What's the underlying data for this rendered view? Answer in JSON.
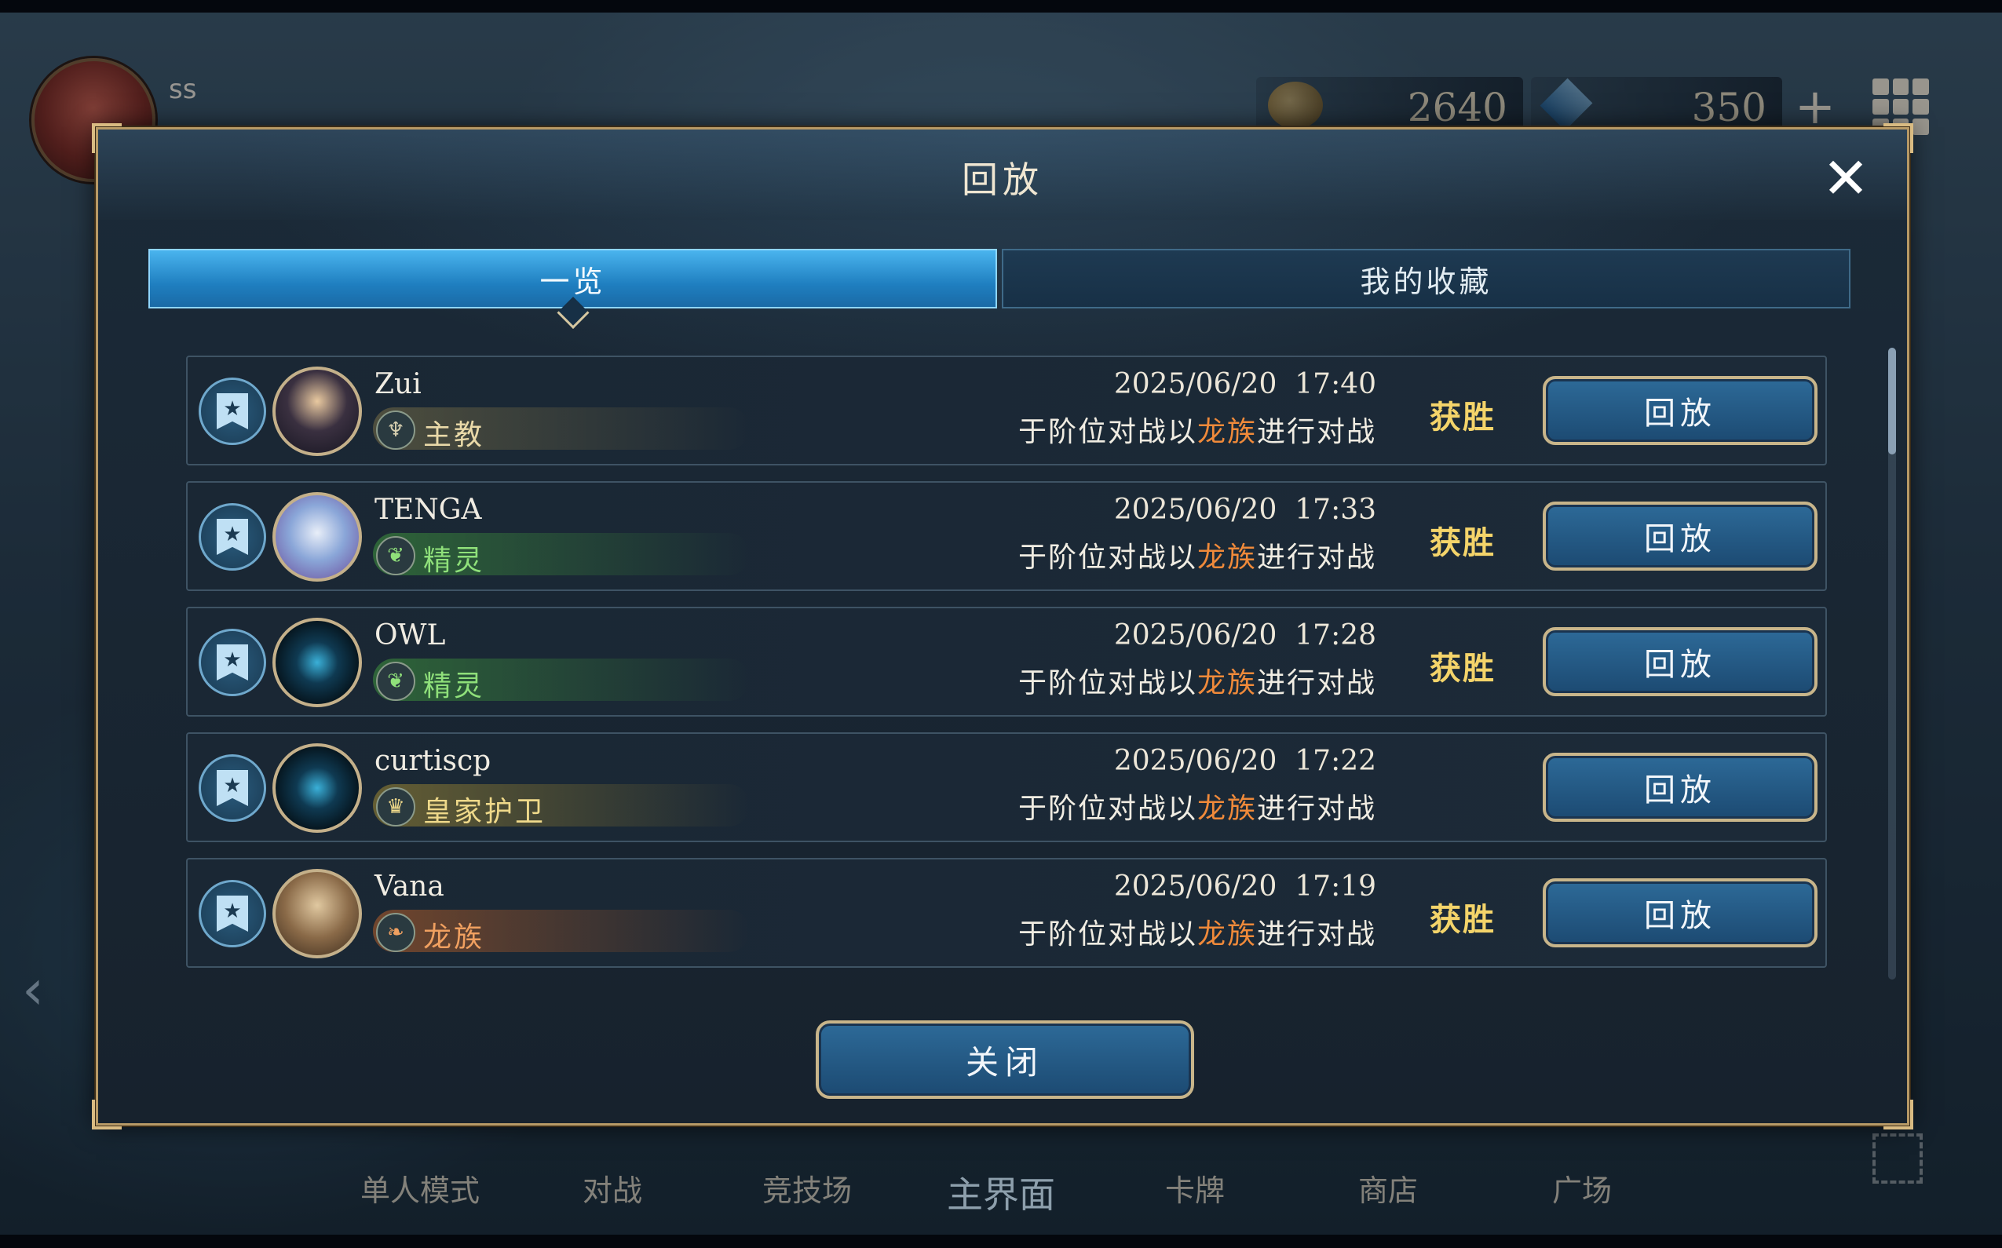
{
  "hud": {
    "player_name": "ss",
    "gold": "2640",
    "crystals": "350",
    "icons": [
      "coin-icon",
      "crystal-icon",
      "plus-icon",
      "grid-menu-icon"
    ]
  },
  "bottom_nav": [
    {
      "label": "单人模式"
    },
    {
      "label": "对战"
    },
    {
      "label": "竞技场"
    },
    {
      "label": "主界面"
    },
    {
      "label": "卡牌"
    },
    {
      "label": "商店"
    },
    {
      "label": "广场"
    }
  ],
  "modal": {
    "title": "回放",
    "close_icon": "close-x",
    "tabs": [
      {
        "label": "一览",
        "active": true
      },
      {
        "label": "我的收藏",
        "active": false
      }
    ],
    "replays": [
      {
        "name": "Zui",
        "class_label": "主教",
        "class_icon": "bishop-icon",
        "class_color": "#e9d9a8",
        "datetime": "2025/06/20  17:40",
        "desc_pre": "于阶位对战以",
        "desc_highlight": "龙族",
        "desc_post": "进行对战",
        "result": "获胜",
        "button": "回放"
      },
      {
        "name": "TENGA",
        "class_label": "精灵",
        "class_icon": "leaf-icon",
        "class_color": "#8fe07a",
        "datetime": "2025/06/20  17:33",
        "desc_pre": "于阶位对战以",
        "desc_highlight": "龙族",
        "desc_post": "进行对战",
        "result": "获胜",
        "button": "回放"
      },
      {
        "name": "OWL",
        "class_label": "精灵",
        "class_icon": "leaf-icon",
        "class_color": "#8fe07a",
        "datetime": "2025/06/20  17:28",
        "desc_pre": "于阶位对战以",
        "desc_highlight": "龙族",
        "desc_post": "进行对战",
        "result": "获胜",
        "button": "回放"
      },
      {
        "name": "curtiscp",
        "class_label": "皇家护卫",
        "class_icon": "crown-icon",
        "class_color": "#efd98a",
        "datetime": "2025/06/20  17:22",
        "desc_pre": "于阶位对战以",
        "desc_highlight": "龙族",
        "desc_post": "进行对战",
        "result": "",
        "button": "回放"
      },
      {
        "name": "Vana",
        "class_label": "龙族",
        "class_icon": "dragon-icon",
        "class_color": "#f0a060",
        "datetime": "2025/06/20  17:19",
        "desc_pre": "于阶位对战以",
        "desc_highlight": "龙族",
        "desc_post": "进行对战",
        "result": "获胜",
        "button": "回放"
      }
    ],
    "close_button": "关闭"
  }
}
